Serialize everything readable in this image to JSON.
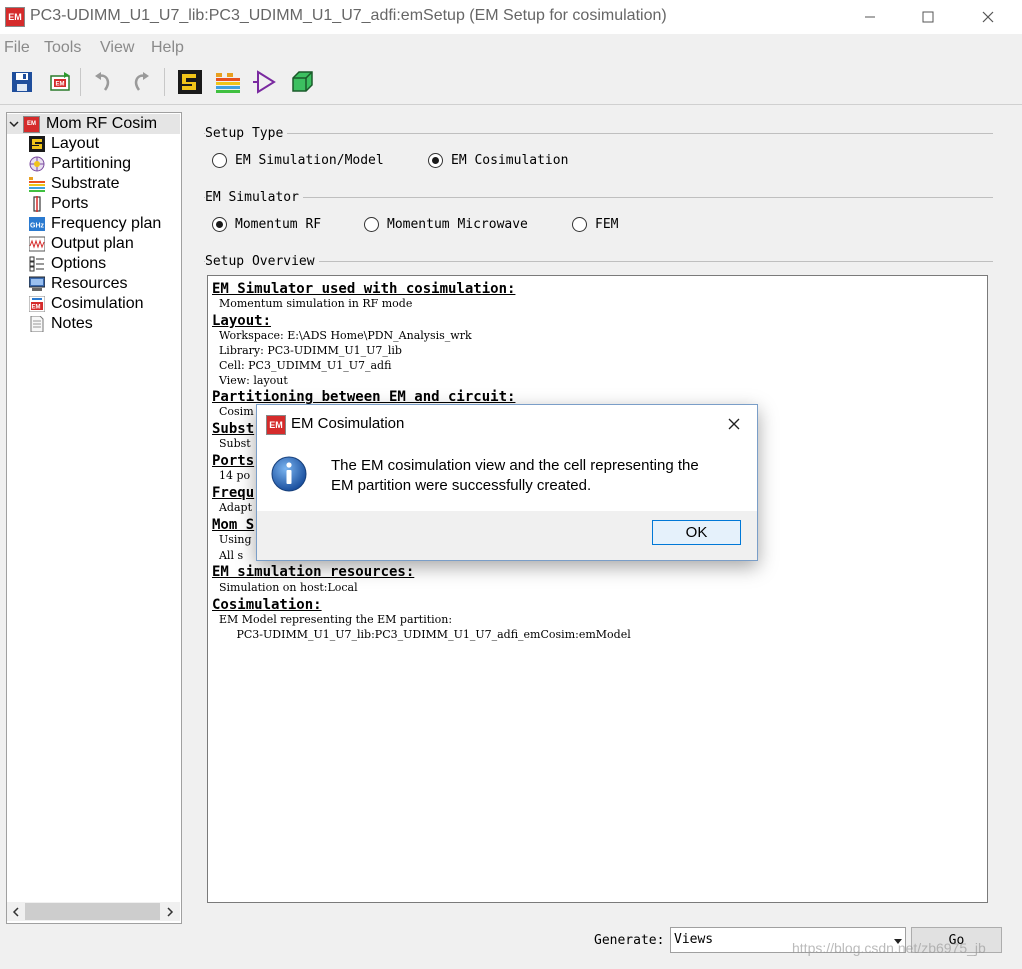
{
  "window": {
    "title": "PC3-UDIMM_U1_U7_lib:PC3_UDIMM_U1_U7_adfi:emSetup (EM Setup for cosimulation)",
    "app_icon": "EM",
    "controls": [
      "minimize-icon",
      "maximize-icon",
      "close-icon"
    ]
  },
  "menu": [
    "File",
    "Tools",
    "View",
    "Help"
  ],
  "toolbar": [
    "save-icon",
    "em-export-icon",
    "undo-icon",
    "redo-icon",
    "layout-icon",
    "substrate-icon",
    "port-icon",
    "3d-view-icon"
  ],
  "tree": {
    "root": "Mom RF Cosim",
    "items": [
      "Layout",
      "Partitioning",
      "Substrate",
      "Ports",
      "Frequency plan",
      "Output plan",
      "Options",
      "Resources",
      "Cosimulation",
      "Notes"
    ]
  },
  "setup_type": {
    "label": "Setup Type",
    "options": [
      {
        "label": "EM Simulation/Model",
        "selected": false
      },
      {
        "label": "EM Cosimulation",
        "selected": true
      }
    ]
  },
  "em_simulator": {
    "label": "EM Simulator",
    "options": [
      {
        "label": "Momentum RF",
        "selected": true
      },
      {
        "label": "Momentum Microwave",
        "selected": false
      },
      {
        "label": "FEM",
        "selected": false
      }
    ]
  },
  "overview": {
    "label": "Setup Overview",
    "lines": [
      {
        "text": "EM Simulator used with cosimulation:",
        "heading": true
      },
      {
        "text": "  Momentum simulation in RF mode",
        "heading": false
      },
      {
        "text": "Layout:",
        "heading": true
      },
      {
        "text": "  Workspace: E:\\ADS Home\\PDN_Analysis_wrk",
        "heading": false
      },
      {
        "text": "  Library: PC3-UDIMM_U1_U7_lib",
        "heading": false
      },
      {
        "text": "  Cell: PC3_UDIMM_U1_U7_adfi",
        "heading": false
      },
      {
        "text": "  View: layout",
        "heading": false
      },
      {
        "text": "Partitioning between EM and circuit:",
        "heading": true
      },
      {
        "text": "  Cosim",
        "heading": false
      },
      {
        "text": "Subst",
        "heading": true
      },
      {
        "text": "  Subst",
        "heading": false
      },
      {
        "text": "Ports",
        "heading": true
      },
      {
        "text": "  14 po",
        "heading": false
      },
      {
        "text": "Frequ",
        "heading": true
      },
      {
        "text": "  Adapt",
        "heading": false
      },
      {
        "text": "Mom S",
        "heading": true
      },
      {
        "text": "  Using",
        "heading": false
      },
      {
        "text": "  All s",
        "heading": false
      },
      {
        "text": "EM simulation resources:",
        "heading": true
      },
      {
        "text": "  Simulation on host:Local",
        "heading": false
      },
      {
        "text": "Cosimulation:",
        "heading": true
      },
      {
        "text": "  EM Model representing the EM partition:",
        "heading": false
      },
      {
        "text": "       PC3-UDIMM_U1_U7_lib:PC3_UDIMM_U1_U7_adfi_emCosim:emModel",
        "heading": false
      }
    ]
  },
  "dialog": {
    "title": "EM Cosimulation",
    "icon": "EM",
    "message_line1": "The EM cosimulation view and the cell representing the",
    "message_line2": "EM partition were successfully created.",
    "ok_label": "OK"
  },
  "bottom": {
    "generate_label": "Generate:",
    "generate_value": "Views",
    "go_label": "Go"
  },
  "watermark": "https://blog.csdn.net/zb6975_jb"
}
